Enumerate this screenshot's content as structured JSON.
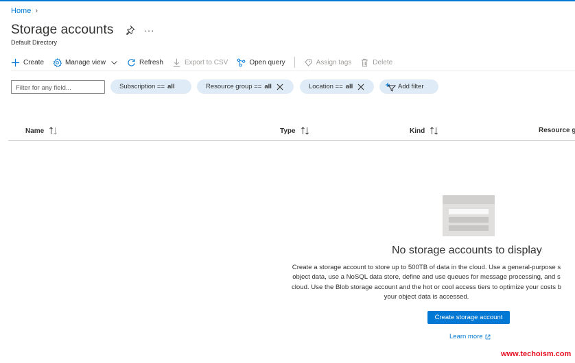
{
  "breadcrumb": {
    "home": "Home"
  },
  "header": {
    "title": "Storage accounts",
    "subtitle": "Default Directory",
    "more": "···"
  },
  "toolbar": {
    "create": "Create",
    "manage_view": "Manage view",
    "refresh": "Refresh",
    "export_csv": "Export to CSV",
    "open_query": "Open query",
    "assign_tags": "Assign tags",
    "delete": "Delete"
  },
  "filters": {
    "placeholder": "Filter for any field...",
    "subscription": {
      "label": "Subscription ==",
      "value": "all"
    },
    "resource_group": {
      "label": "Resource group ==",
      "value": "all"
    },
    "location": {
      "label": "Location ==",
      "value": "all"
    },
    "add_filter": "Add filter"
  },
  "columns": [
    "Name",
    "Type",
    "Kind",
    "Resource gr"
  ],
  "empty_state": {
    "title": "No storage accounts to display",
    "description_lines": [
      "Create a storage account to store up to 500TB of data in the cloud. Use a general-purpose s",
      "object data, use a NoSQL data store, define and use queues for message processing, and s",
      "cloud. Use the Blob storage account and the hot or cool access tiers to optimize your costs b",
      "your object data is accessed."
    ],
    "create_button": "Create storage account",
    "learn_more": "Learn more"
  },
  "watermark": "www.techoism.com",
  "colors": {
    "accent": "#0078d4",
    "pill_bg": "#dfecf7",
    "watermark": "#e81123"
  }
}
